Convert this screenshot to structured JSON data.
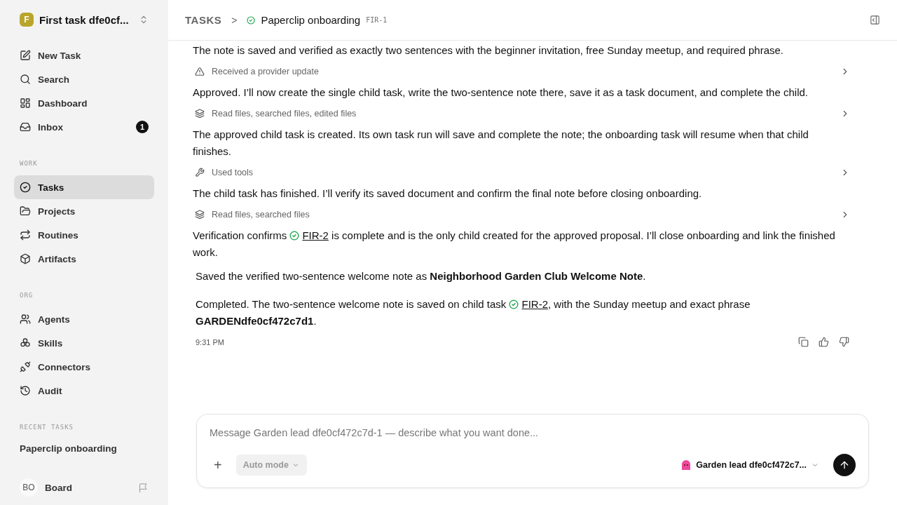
{
  "workspace": {
    "initial": "F",
    "name": "First task dfe0cf..."
  },
  "nav": [
    {
      "label": "New Task"
    },
    {
      "label": "Search"
    },
    {
      "label": "Dashboard"
    },
    {
      "label": "Inbox",
      "count": "1"
    }
  ],
  "sections": [
    {
      "title": "WORK",
      "items": [
        {
          "label": "Tasks",
          "selected": true
        },
        {
          "label": "Projects",
          "selected": false
        },
        {
          "label": "Routines",
          "selected": false
        },
        {
          "label": "Artifacts",
          "selected": false
        }
      ]
    },
    {
      "title": "ORG",
      "items": [
        {
          "label": "Agents",
          "selected": false
        },
        {
          "label": "Skills",
          "selected": false
        },
        {
          "label": "Connectors",
          "selected": false
        },
        {
          "label": "Audit",
          "selected": false
        }
      ]
    }
  ],
  "recent": {
    "title": "RECENT TASKS",
    "items": [
      "Paperclip onboarding"
    ]
  },
  "user": {
    "initials": "BO",
    "name": "Board"
  },
  "breadcrumb": {
    "root": "TASKS",
    "separator": ">",
    "title": "Paperclip onboarding",
    "id": "FIR-1"
  },
  "feed": [
    {
      "kind": "text",
      "parts": [
        {
          "kind": "text",
          "text": "The note is saved and verified as exactly two sentences with the beginner invitation, free Sunday meetup, and required phrase."
        }
      ]
    },
    {
      "kind": "activity",
      "label": "Received a provider update"
    },
    {
      "kind": "text",
      "parts": [
        {
          "kind": "text",
          "text": "Approved. I’ll now create the single child task, write the two-sentence note there, save it as a task document, and complete the child."
        }
      ]
    },
    {
      "kind": "activity",
      "label": "Read files, searched files, edited files"
    },
    {
      "kind": "text",
      "parts": [
        {
          "kind": "text",
          "text": "The approved child task is created. Its own task run will save and complete the note; the onboarding task will resume when that child finishes."
        }
      ]
    },
    {
      "kind": "activity",
      "label": "Used tools"
    },
    {
      "kind": "text",
      "parts": [
        {
          "kind": "text",
          "text": "The child task has finished. I’ll verify its saved document and confirm the final note before closing onboarding."
        }
      ]
    },
    {
      "kind": "activity",
      "label": "Read files, searched files"
    },
    {
      "kind": "text",
      "parts": [
        {
          "kind": "text",
          "text": "Verification confirms "
        },
        {
          "kind": "link",
          "text": "FIR-2"
        },
        {
          "kind": "text",
          "text": " is complete and is the only child created for the approved proposal. I’ll close onboarding and link the finished work."
        }
      ]
    },
    {
      "kind": "result",
      "parts": [
        {
          "kind": "text",
          "text": "Saved the verified two-sentence welcome note as **Neighborhood Garden Club Welcome Note**."
        }
      ]
    },
    {
      "kind": "result",
      "parts": [
        {
          "kind": "text",
          "text": "Completed. The two-sentence welcome note is saved on child task "
        },
        {
          "kind": "link",
          "text": "FIR-2"
        },
        {
          "kind": "text",
          "text": ", with the Sunday meetup and exact phrase **GARDENdfe0cf472c7d1**."
        }
      ]
    }
  ],
  "timestamp": "9:31 PM",
  "composer": {
    "placeholder": "Message Garden lead dfe0cf472c7d-1 — describe what you want done...",
    "plus": "+",
    "mode": "Auto mode",
    "agent": "Garden lead dfe0cf472c7..."
  }
}
